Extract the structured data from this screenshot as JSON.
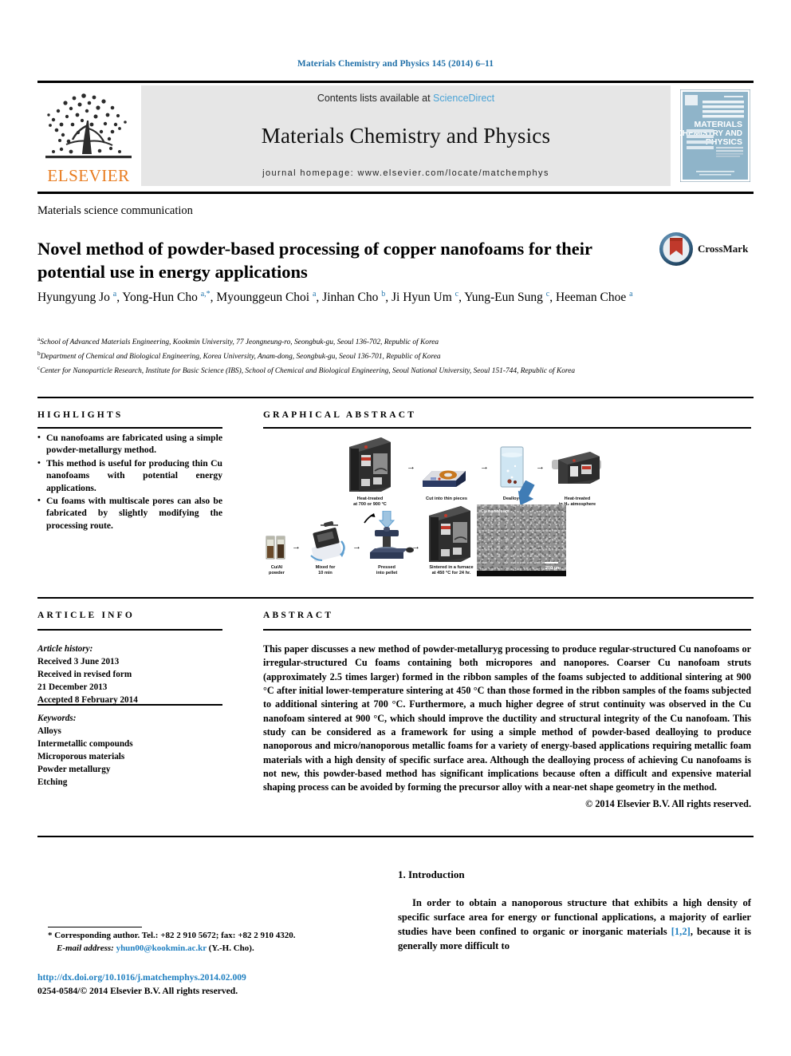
{
  "running_head": "Materials Chemistry and Physics 145 (2014) 6–11",
  "masthead": {
    "publisher": "ELSEVIER",
    "contents_prefix": "Contents lists available at ",
    "contents_link": "ScienceDirect",
    "journal_name": "Materials Chemistry and Physics",
    "homepage": "journal homepage: www.elsevier.com/locate/matchemphys",
    "cover_title_lines": [
      "MATERIALS",
      "CHEMISTRY AND",
      "PHYSICS"
    ]
  },
  "article": {
    "type": "Materials science communication",
    "title": "Novel method of powder-based processing of copper nanofoams for their potential use in energy applications",
    "crossmark_label": "CrossMark",
    "authors_html": "Hyungyung Jo <sup>a</sup>, Yong-Hun Cho <sup>a,*</sup>, Myounggeun Choi <sup>a</sup>, Jinhan Cho <sup>b</sup>, Ji Hyun Um <sup>c</sup>, Yung-Eun Sung <sup>c</sup>, Heeman Choe <sup>a</sup>",
    "affiliations": [
      "School of Advanced Materials Engineering, Kookmin University, 77 Jeongneung-ro, Seongbuk-gu, Seoul 136-702, Republic of Korea",
      "Department of Chemical and Biological Engineering, Korea University, Anam-dong, Seongbuk-gu, Seoul 136-701, Republic of Korea",
      "Center for Nanoparticle Research, Institute for Basic Science (IBS), School of Chemical and Biological Engineering, Seoul National University, Seoul 151-744, Republic of Korea"
    ],
    "affiliation_marks": [
      "a",
      "b",
      "c"
    ]
  },
  "highlights": {
    "heading": "HIGHLIGHTS",
    "items": [
      "Cu nanofoams are fabricated using a simple powder-metallurgy method.",
      "This method is useful for producing thin Cu nanofoams with potential energy applications.",
      "Cu foams with multiscale pores can also be fabricated by slightly modifying the processing route."
    ]
  },
  "graphical_abstract": {
    "heading": "GRAPHICAL ABSTRACT",
    "bottom_row_labels": [
      "Cu/Al\npowder",
      "Mixed for\n10 min",
      "Pressed\ninto pellet",
      "Sintered in a furnace\nat 450 °C for 24 hr."
    ],
    "top_row_labels": [
      "Heat-treated\nat 700 or 900 °C",
      "Cut into thin pieces",
      "Dealloyed",
      "Heat-treated\nin H₂ atmosphere"
    ],
    "sem_caption": "Cu nanofoam",
    "sem_scale": "200 µm",
    "arrow_glyph": "→"
  },
  "article_info": {
    "heading": "ARTICLE INFO",
    "history_label": "Article history:",
    "history_lines": [
      "Received 3 June 2013",
      "Received in revised form",
      "21 December 2013",
      "Accepted 8 February 2014"
    ],
    "keywords_label": "Keywords:",
    "keywords": [
      "Alloys",
      "Intermetallic compounds",
      "Microporous materials",
      "Powder metallurgy",
      "Etching"
    ]
  },
  "abstract": {
    "heading": "ABSTRACT",
    "text": "This paper discusses a new method of powder-metalluryg processing to produce regular-structured Cu nanofoams or irregular-structured Cu foams containing both micropores and nanopores. Coarser Cu nanofoam struts (approximately 2.5 times larger) formed in the ribbon samples of the foams subjected to additional sintering at 900 °C after initial lower-temperature sintering at 450 °C than those formed in the ribbon samples of the foams subjected to additional sintering at 700 °C. Furthermore, a much higher degree of strut continuity was observed in the Cu nanofoam sintered at 900 °C, which should improve the ductility and structural integrity of the Cu nanofoam. This study can be considered as a framework for using a simple method of powder-based dealloying to produce nanoporous and micro/nanoporous metallic foams for a variety of energy-based applications requiring metallic foam materials with a high density of specific surface area. Although the dealloying process of achieving Cu nanofoams is not new, this powder-based method has significant implications because often a difficult and expensive material shaping process can be avoided by forming the precursor alloy with a near-net shape geometry in the method.",
    "copyright": "© 2014 Elsevier B.V. All rights reserved."
  },
  "introduction": {
    "number_and_title": "1. Introduction",
    "paragraph_part1": "In order to obtain a nanoporous structure that exhibits a high density of specific surface area for energy or functional applications, a majority of earlier studies have been confined to organic or inorganic materials ",
    "reference": "[1,2]",
    "paragraph_part2": ", because it is generally more difficult to"
  },
  "footer": {
    "corresponding_marker": "*",
    "corresponding_text": "Corresponding author. Tel.: +82 2 910 5672; fax: +82 2 910 4320.",
    "email_label": "E-mail address:",
    "email": "yhun00@kookmin.ac.kr",
    "email_suffix": "(Y.-H. Cho).",
    "doi_url": "http://dx.doi.org/10.1016/j.matchemphys.2014.02.009",
    "issn_line": "0254-0584/© 2014 Elsevier B.V. All rights reserved."
  },
  "colors": {
    "link_blue": "#1f7fc0",
    "sciencedirect_blue": "#4aa3d6",
    "elsevier_orange": "#E87B1E",
    "band_gray": "#e6e6e6",
    "cover_blue": "#8fb4c9"
  }
}
